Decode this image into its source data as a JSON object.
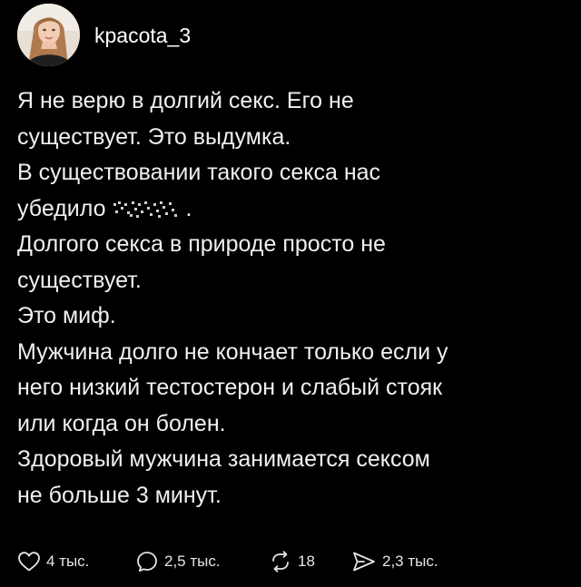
{
  "post": {
    "author": {
      "username": "kpacota_3",
      "avatar_icon": "user-avatar-photo"
    },
    "lines": [
      "Я не верю в долгий секс. Его не",
      "существует. Это выдумка.",
      "В существовании такого секса нас",
      "убедило",
      "Долгого секса в природе просто не",
      "существует.",
      "Это миф.",
      "Мужчина долго не кончает только если у",
      "него низкий тестостерон и слабый стояк",
      "или когда он болен.",
      "Здоровый мужчина занимается сексом",
      "не больше 3 минут."
    ],
    "censored_suffix": "."
  },
  "actions": {
    "likes": {
      "icon": "heart-icon",
      "count": "4 тыс."
    },
    "comments": {
      "icon": "comment-icon",
      "count": "2,5 тыс."
    },
    "reposts": {
      "icon": "repost-icon",
      "count": "18"
    },
    "shares": {
      "icon": "share-icon",
      "count": "2,3 тыс."
    }
  },
  "colors": {
    "background": "#000000",
    "text": "#f0f0f0",
    "icon": "#e6e6e6"
  }
}
